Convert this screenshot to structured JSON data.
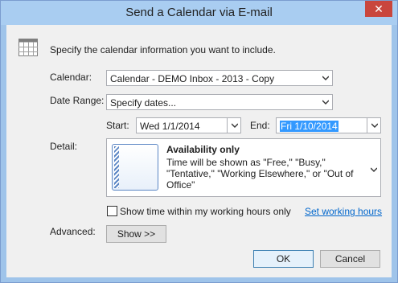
{
  "window": {
    "title": "Send a Calendar via E-mail",
    "close_glyph": "✕"
  },
  "intro": {
    "icon": "calendar-grid-icon",
    "text": "Specify the calendar information you want to include."
  },
  "calendar": {
    "label": "Calendar:",
    "value": "Calendar - DEMO Inbox - 2013 - Copy"
  },
  "date_range": {
    "label": "Date Range:",
    "value": "Specify dates..."
  },
  "start": {
    "label": "Start:",
    "value": "Wed 1/1/2014"
  },
  "end": {
    "label": "End:",
    "value": "Fri 1/10/2014"
  },
  "detail": {
    "label": "Detail:",
    "title": "Availability only",
    "description": "Time will be shown as \"Free,\" \"Busy,\" \"Tentative,\" \"Working Elsewhere,\" or \"Out of Office\""
  },
  "working_hours": {
    "checkbox_label": "Show time within my working hours only",
    "checked": false,
    "link": "Set working hours"
  },
  "advanced": {
    "label": "Advanced:",
    "button": "Show >>"
  },
  "buttons": {
    "ok": "OK",
    "cancel": "Cancel"
  },
  "colors": {
    "accent": "#3399ff",
    "link": "#0066cc",
    "close": "#c9463d"
  }
}
